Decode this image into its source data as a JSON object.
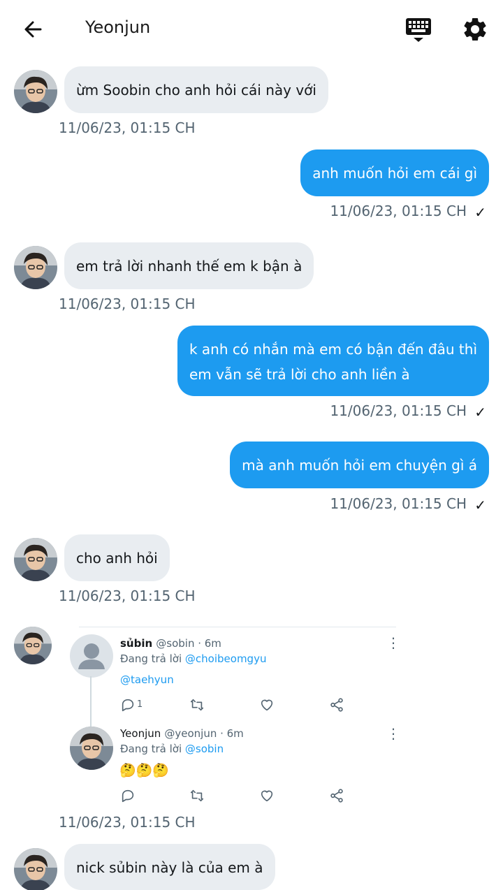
{
  "header": {
    "title": "Yeonjun",
    "icons": [
      "arrow-left-icon",
      "keyboard-icon",
      "gear-icon"
    ]
  },
  "messages": [
    {
      "dir": "in",
      "text": "ừm Soobin cho anh hỏi cái này với",
      "time": "11/06/23,  01:15 CH"
    },
    {
      "dir": "out",
      "text": "anh muốn hỏi em cái gì",
      "time": "11/06/23,  01:15 CH"
    },
    {
      "dir": "in",
      "text": "em trả lời nhanh thế em k bận à",
      "time": "11/06/23,  01:15 CH"
    },
    {
      "dir": "out",
      "lines": [
        "k anh có nhắn mà em có bận đến đâu thì",
        "em vẫn sẽ trả lời cho anh liền à"
      ],
      "time": "11/06/23,  01:15 CH"
    },
    {
      "dir": "out",
      "text": "mà anh muốn hỏi em chuyện gì á",
      "time": "11/06/23,  01:15 CH"
    },
    {
      "dir": "in",
      "text": "cho anh hỏi",
      "time": "11/06/23,  01:15 CH"
    },
    {
      "dir": "in-card",
      "time": "11/06/23,  01:15 CH"
    },
    {
      "dir": "in",
      "text": "nick sủbin này là của em à"
    }
  ],
  "check_mark": "✓",
  "shared_tweet": {
    "first": {
      "name": "sủbin",
      "handle": "@sobin · 6m",
      "reply_prefix": "Đang trả lời",
      "reply_user": "@choibeomgyu",
      "mention": "@taehyun",
      "reply_count": "1"
    },
    "second": {
      "name": "Yeonjun",
      "handle": "@yeonjun · 6m",
      "reply_prefix": "Đang trả lời",
      "reply_user": "@sobin",
      "emoji": "🤔🤔🤔"
    },
    "more_icon": "⋮"
  },
  "colors": {
    "outgoing": "#1d9bf0",
    "incoming": "#e9edf1",
    "timestamp": "#536471"
  }
}
